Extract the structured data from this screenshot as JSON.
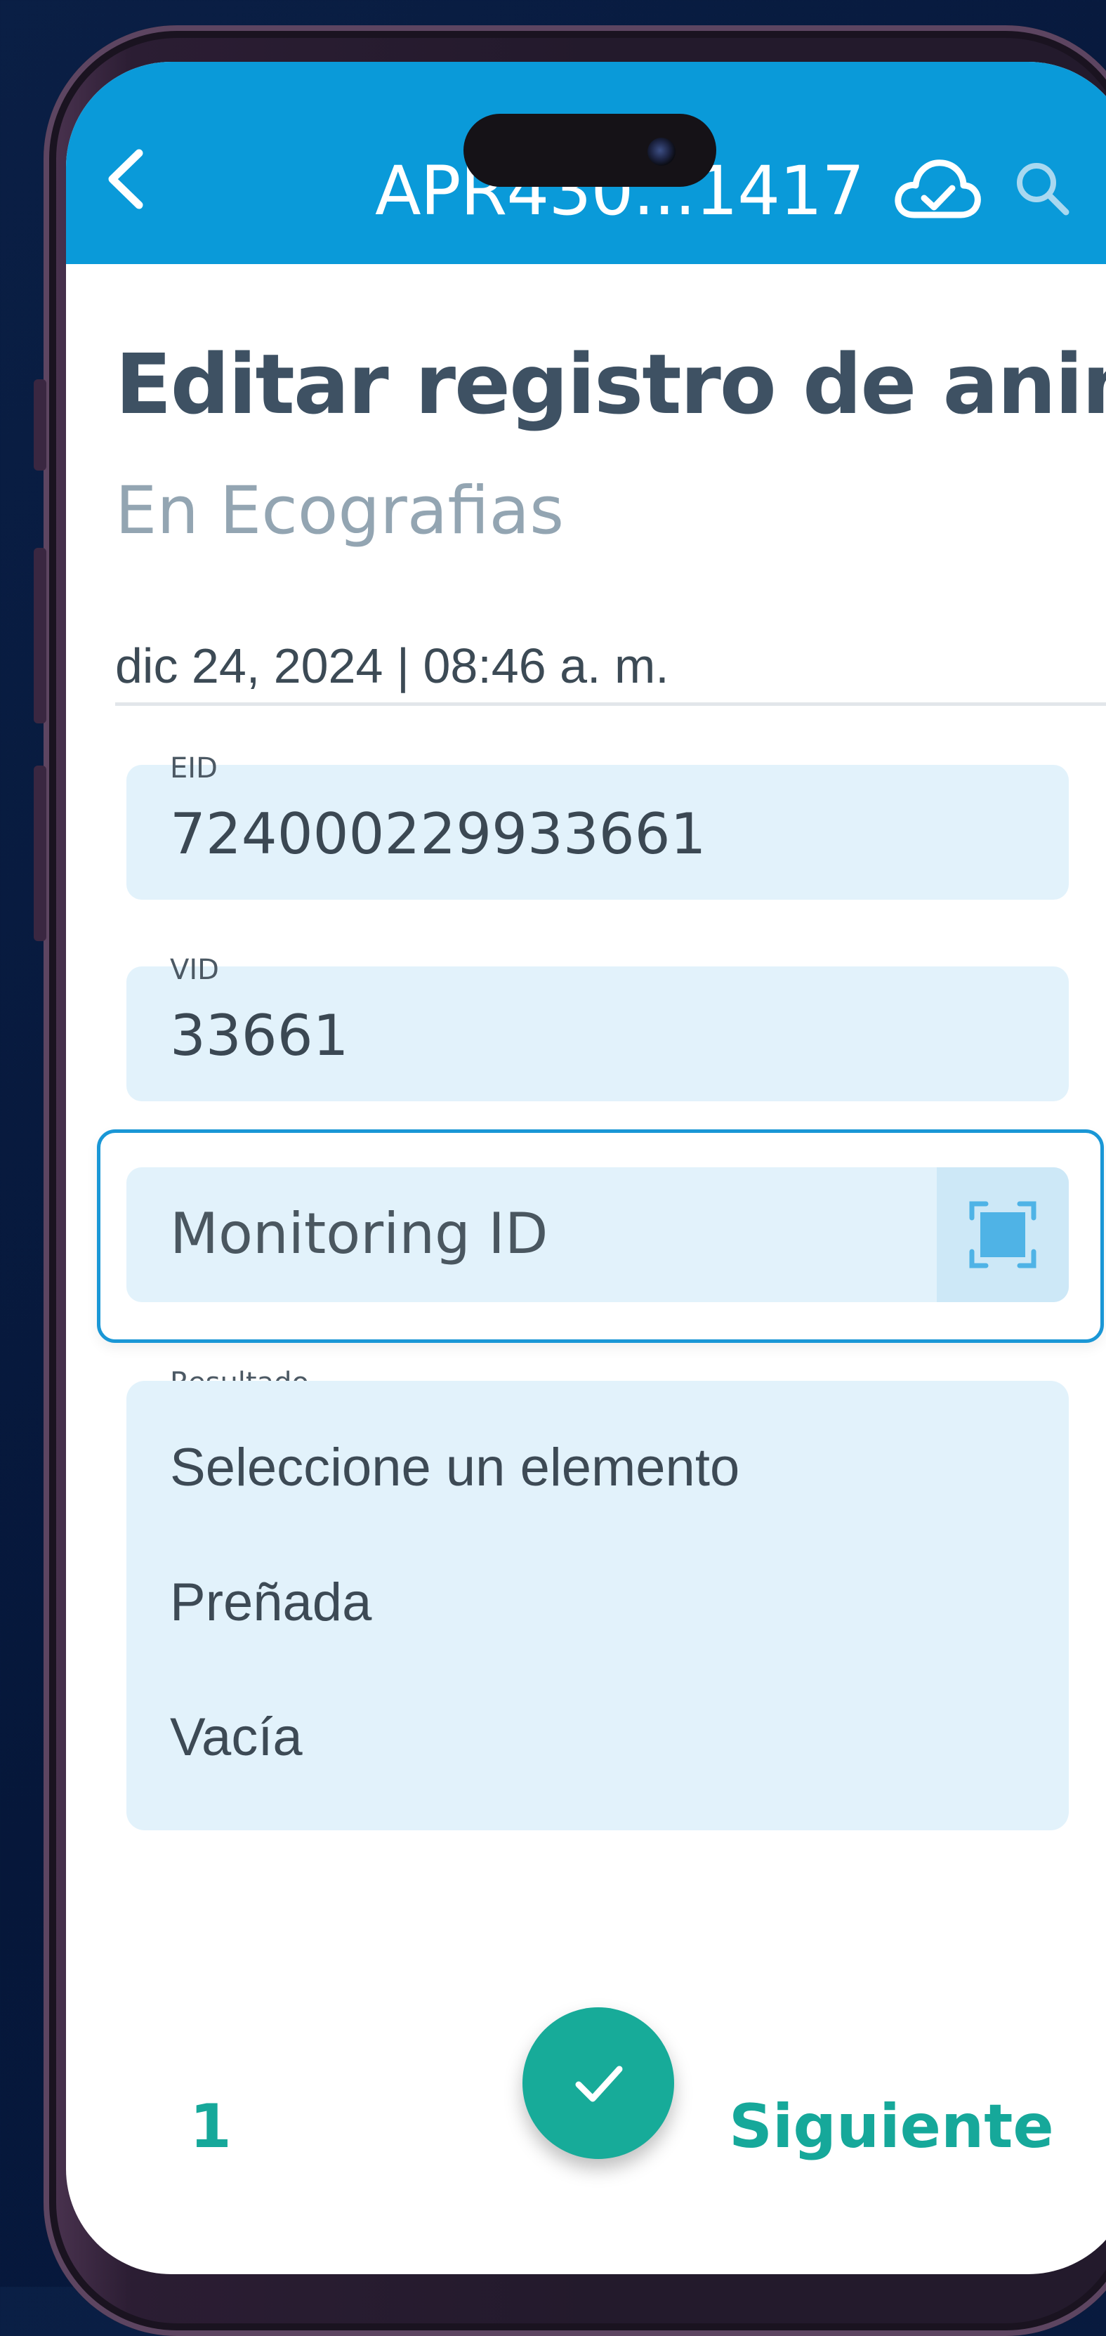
{
  "header": {
    "title": "APR430...1417",
    "icons": [
      "back-arrow-icon",
      "cloud-sync-icon",
      "search-icon"
    ],
    "color": "#0a9ad9"
  },
  "page": {
    "title": "Editar registro de anim…",
    "subtitle": "En Ecografias",
    "datetime": "dic 24, 2024 | 08:46 a. m."
  },
  "form": {
    "eid": {
      "label": "EID",
      "value": "724000229933661"
    },
    "vid": {
      "label": "VID",
      "value": "33661"
    },
    "monitoring": {
      "placeholder": "Monitoring ID",
      "icon": "scan-icon"
    },
    "result": {
      "label": "Resultado",
      "options": [
        "Seleccione un elemento",
        "Preñada",
        "Vacía"
      ]
    }
  },
  "footer": {
    "page_number": "1",
    "confirm_icon": "check-icon",
    "next_label": "Siguiente",
    "accent": "#16a89a"
  }
}
